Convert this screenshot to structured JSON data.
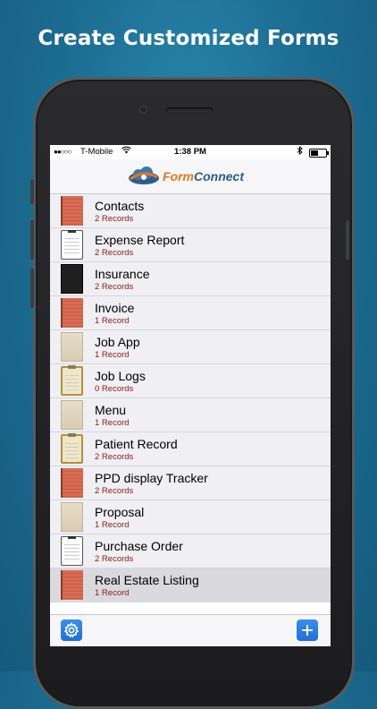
{
  "headline": "Create Customized Forms",
  "status_bar": {
    "signal": "●●○○○",
    "carrier": "T-Mobile",
    "time": "1:38 PM"
  },
  "app": {
    "logo_form": "Form",
    "logo_connect": "Connect"
  },
  "forms": [
    {
      "name": "Contacts",
      "records": "2 Records",
      "thumb": "red"
    },
    {
      "name": "Expense Report",
      "records": "2 Records",
      "thumb": "white"
    },
    {
      "name": "Insurance",
      "records": "2 Records",
      "thumb": "black"
    },
    {
      "name": "Invoice",
      "records": "1 Record",
      "thumb": "red"
    },
    {
      "name": "Job App",
      "records": "1 Record",
      "thumb": "tan"
    },
    {
      "name": "Job Logs",
      "records": "0 Records",
      "thumb": "clip"
    },
    {
      "name": "Menu",
      "records": "1 Record",
      "thumb": "tan"
    },
    {
      "name": "Patient Record",
      "records": "2 Records",
      "thumb": "clip"
    },
    {
      "name": "PPD display Tracker",
      "records": "2 Records",
      "thumb": "red"
    },
    {
      "name": "Proposal",
      "records": "1 Record",
      "thumb": "tan"
    },
    {
      "name": "Purchase Order",
      "records": "2 Records",
      "thumb": "white"
    },
    {
      "name": "Real Estate Listing",
      "records": "1 Record",
      "thumb": "red",
      "selected": true
    }
  ],
  "toolbar": {
    "settings_icon": "gear-icon",
    "add_icon": "plus-icon"
  },
  "colors": {
    "background": "#1d6f94",
    "accent": "#1f6fd9",
    "record_count": "#8a1a14",
    "logo_orange": "#e8741c",
    "logo_blue": "#2a5d8e"
  }
}
